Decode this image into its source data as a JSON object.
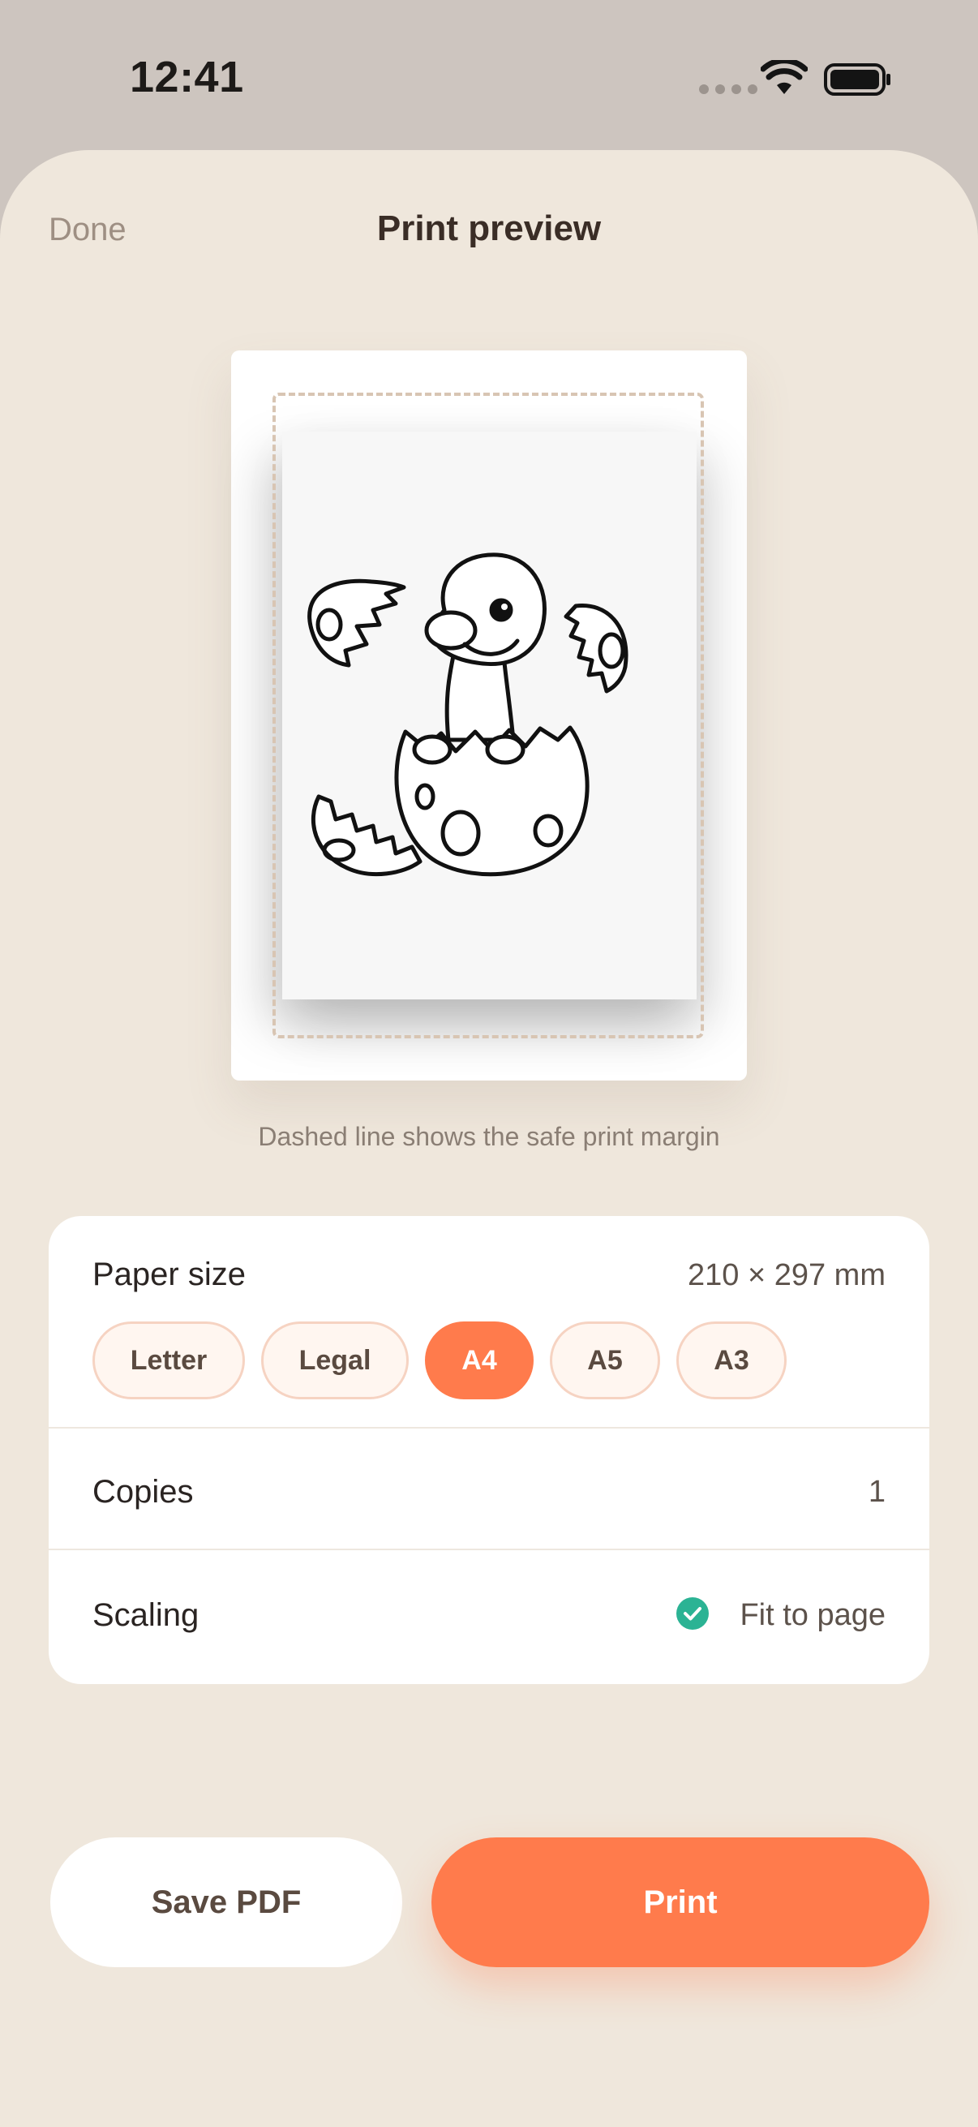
{
  "status_bar": {
    "time": "12:41"
  },
  "header": {
    "done_label": "Done",
    "title": "Print preview"
  },
  "preview": {
    "caption": "Dashed line shows the safe print margin"
  },
  "settings": {
    "paper_size": {
      "label": "Paper size",
      "value": "210 × 297 mm",
      "options": [
        "Letter",
        "Legal",
        "A4",
        "A5",
        "A3"
      ],
      "selected": "A4"
    },
    "copies": {
      "label": "Copies",
      "value": "1"
    },
    "scaling": {
      "label": "Scaling",
      "value": "Fit to page"
    }
  },
  "actions": {
    "save_pdf_label": "Save PDF",
    "print_label": "Print"
  },
  "colors": {
    "accent": "#ff7b4c",
    "check": "#2bb394",
    "sheet_bg": "#efe7dc"
  }
}
